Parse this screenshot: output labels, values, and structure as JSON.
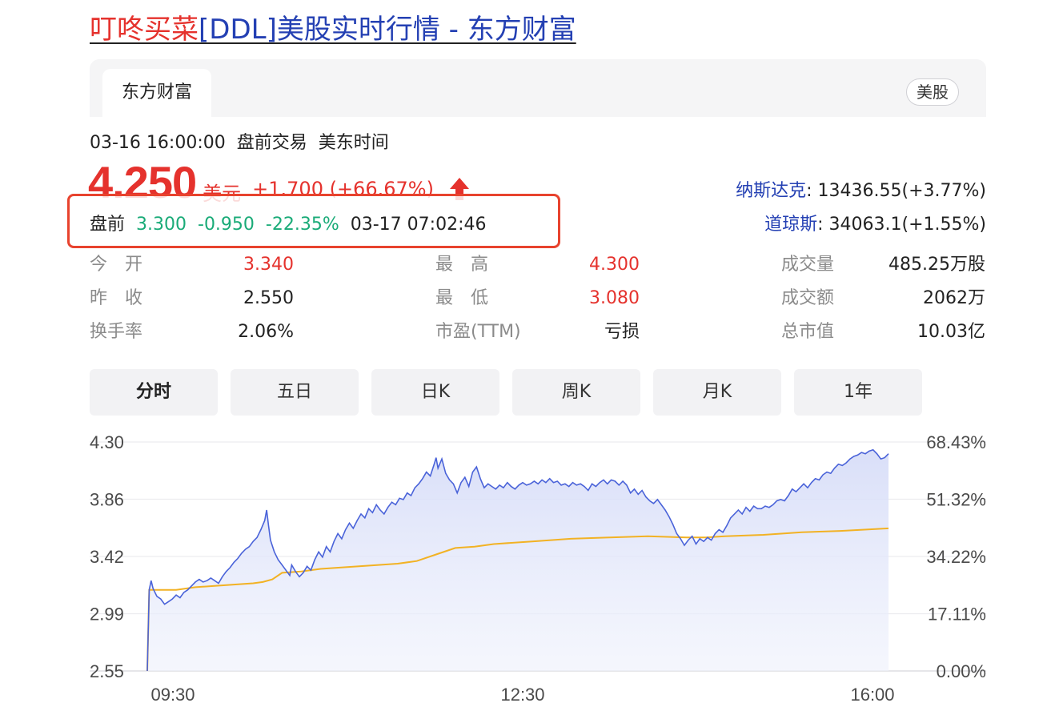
{
  "header": {
    "title_part1": "叮咚买菜",
    "title_part2": "[DDL]美股实时行情 - 东方财富"
  },
  "source": {
    "tab_label": "东方财富",
    "market_badge": "美股"
  },
  "quote": {
    "datetime": "03-16 16:00:00",
    "session": "盘前交易",
    "timezone": "美东时间",
    "price": "4.250",
    "unit": "美元",
    "change": "+1.700 (+66.67%)",
    "up_color": "#e5322d",
    "down_color": "#1aab78"
  },
  "premarket": {
    "label": "盘前",
    "price": "3.300",
    "change": "-0.950",
    "change_pct": "-22.35%",
    "time": "03-17 07:02:46"
  },
  "indices": [
    {
      "name": "纳斯达克",
      "value": ": 13436.55(+3.77%)"
    },
    {
      "name": "道琼斯",
      "value": ": 34063.1(+1.55%)"
    }
  ],
  "stats": {
    "open_label": "今　开",
    "open": "3.340",
    "high_label": "最　高",
    "high": "4.300",
    "volume_label": "成交量",
    "volume": "485.25万股",
    "prev_close_label": "昨　收",
    "prev_close": "2.550",
    "low_label": "最　低",
    "low": "3.080",
    "turnover_label": "成交额",
    "turnover": "2062万",
    "turnover_rate_label": "换手率",
    "turnover_rate": "2.06%",
    "pe_label": "市盈(TTM)",
    "pe": "亏损",
    "market_cap_label": "总市值",
    "market_cap": "10.03亿"
  },
  "range_tabs": [
    "分时",
    "五日",
    "日K",
    "周K",
    "月K",
    "1年"
  ],
  "active_range_tab": 0,
  "chart_data": {
    "type": "line",
    "x_tick_labels": [
      "09:30",
      "12:30",
      "16:00"
    ],
    "y_left_ticks": [
      "4.30",
      "3.86",
      "3.42",
      "2.99",
      "2.55"
    ],
    "y_right_ticks": [
      "68.43%",
      "51.32%",
      "34.22%",
      "17.11%",
      "0.00%"
    ],
    "ylim": [
      2.55,
      4.3
    ],
    "x_range_minutes": [
      0,
      390
    ],
    "grid": true,
    "series": [
      {
        "color": "#4a63d9",
        "fill": "#dfe5fb",
        "points": [
          [
            0,
            2.55
          ],
          [
            1,
            3.17
          ],
          [
            2,
            3.24
          ],
          [
            3,
            3.18
          ],
          [
            5,
            3.12
          ],
          [
            7,
            3.1
          ],
          [
            9,
            3.06
          ],
          [
            11,
            3.08
          ],
          [
            13,
            3.1
          ],
          [
            15,
            3.13
          ],
          [
            17,
            3.11
          ],
          [
            19,
            3.15
          ],
          [
            21,
            3.17
          ],
          [
            23,
            3.2
          ],
          [
            25,
            3.23
          ],
          [
            27,
            3.25
          ],
          [
            29,
            3.23
          ],
          [
            31,
            3.24
          ],
          [
            33,
            3.26
          ],
          [
            35,
            3.24
          ],
          [
            37,
            3.22
          ],
          [
            39,
            3.27
          ],
          [
            41,
            3.31
          ],
          [
            43,
            3.34
          ],
          [
            45,
            3.38
          ],
          [
            47,
            3.41
          ],
          [
            49,
            3.45
          ],
          [
            51,
            3.48
          ],
          [
            53,
            3.5
          ],
          [
            55,
            3.54
          ],
          [
            57,
            3.57
          ],
          [
            59,
            3.63
          ],
          [
            61,
            3.7
          ],
          [
            62,
            3.78
          ],
          [
            63,
            3.66
          ],
          [
            64,
            3.55
          ],
          [
            66,
            3.46
          ],
          [
            68,
            3.4
          ],
          [
            70,
            3.36
          ],
          [
            72,
            3.32
          ],
          [
            74,
            3.28
          ],
          [
            75,
            3.36
          ],
          [
            77,
            3.31
          ],
          [
            79,
            3.27
          ],
          [
            81,
            3.3
          ],
          [
            83,
            3.35
          ],
          [
            85,
            3.32
          ],
          [
            87,
            3.4
          ],
          [
            89,
            3.46
          ],
          [
            91,
            3.42
          ],
          [
            93,
            3.5
          ],
          [
            95,
            3.46
          ],
          [
            97,
            3.54
          ],
          [
            99,
            3.6
          ],
          [
            101,
            3.56
          ],
          [
            103,
            3.63
          ],
          [
            105,
            3.68
          ],
          [
            107,
            3.64
          ],
          [
            109,
            3.7
          ],
          [
            111,
            3.75
          ],
          [
            113,
            3.72
          ],
          [
            115,
            3.79
          ],
          [
            117,
            3.76
          ],
          [
            119,
            3.82
          ],
          [
            121,
            3.78
          ],
          [
            123,
            3.75
          ],
          [
            125,
            3.8
          ],
          [
            127,
            3.84
          ],
          [
            129,
            3.82
          ],
          [
            131,
            3.87
          ],
          [
            133,
            3.86
          ],
          [
            135,
            3.91
          ],
          [
            137,
            3.89
          ],
          [
            139,
            3.95
          ],
          [
            141,
            3.98
          ],
          [
            143,
            4.02
          ],
          [
            145,
            4.07
          ],
          [
            147,
            4.04
          ],
          [
            149,
            4.13
          ],
          [
            150,
            4.18
          ],
          [
            151,
            4.1
          ],
          [
            153,
            4.17
          ],
          [
            155,
            4.06
          ],
          [
            157,
            4.01
          ],
          [
            159,
            3.98
          ],
          [
            161,
            3.91
          ],
          [
            163,
            3.99
          ],
          [
            165,
            4.03
          ],
          [
            167,
            3.96
          ],
          [
            169,
            4.07
          ],
          [
            171,
            4.11
          ],
          [
            173,
            4.02
          ],
          [
            175,
            3.95
          ],
          [
            177,
            3.98
          ],
          [
            179,
            3.96
          ],
          [
            181,
            3.94
          ],
          [
            183,
            3.97
          ],
          [
            185,
            3.95
          ],
          [
            187,
            3.99
          ],
          [
            189,
            3.96
          ],
          [
            191,
            3.94
          ],
          [
            193,
            3.97
          ],
          [
            195,
            3.99
          ],
          [
            197,
            3.97
          ],
          [
            199,
            3.98
          ],
          [
            201,
            4.0
          ],
          [
            203,
            3.98
          ],
          [
            205,
            4.01
          ],
          [
            207,
            3.99
          ],
          [
            209,
            4.02
          ],
          [
            211,
            3.99
          ],
          [
            213,
            4.0
          ],
          [
            215,
            3.97
          ],
          [
            217,
            3.98
          ],
          [
            219,
            3.96
          ],
          [
            221,
            3.99
          ],
          [
            223,
            3.97
          ],
          [
            225,
            3.98
          ],
          [
            227,
            3.96
          ],
          [
            229,
            3.93
          ],
          [
            231,
            3.98
          ],
          [
            233,
            3.96
          ],
          [
            235,
            3.99
          ],
          [
            237,
            4.01
          ],
          [
            239,
            3.98
          ],
          [
            241,
            4.01
          ],
          [
            243,
            4.0
          ],
          [
            245,
            3.97
          ],
          [
            247,
            4.0
          ],
          [
            249,
            3.97
          ],
          [
            251,
            3.91
          ],
          [
            253,
            3.94
          ],
          [
            255,
            3.9
          ],
          [
            257,
            3.93
          ],
          [
            259,
            3.88
          ],
          [
            261,
            3.85
          ],
          [
            263,
            3.83
          ],
          [
            265,
            3.86
          ],
          [
            267,
            3.82
          ],
          [
            269,
            3.78
          ],
          [
            271,
            3.73
          ],
          [
            273,
            3.67
          ],
          [
            275,
            3.6
          ],
          [
            277,
            3.56
          ],
          [
            279,
            3.51
          ],
          [
            281,
            3.55
          ],
          [
            283,
            3.58
          ],
          [
            285,
            3.52
          ],
          [
            287,
            3.56
          ],
          [
            289,
            3.54
          ],
          [
            291,
            3.57
          ],
          [
            293,
            3.55
          ],
          [
            295,
            3.6
          ],
          [
            297,
            3.63
          ],
          [
            299,
            3.61
          ],
          [
            301,
            3.66
          ],
          [
            303,
            3.72
          ],
          [
            305,
            3.75
          ],
          [
            307,
            3.78
          ],
          [
            309,
            3.75
          ],
          [
            311,
            3.8
          ],
          [
            313,
            3.77
          ],
          [
            315,
            3.81
          ],
          [
            317,
            3.79
          ],
          [
            319,
            3.79
          ],
          [
            321,
            3.81
          ],
          [
            323,
            3.8
          ],
          [
            325,
            3.82
          ],
          [
            327,
            3.85
          ],
          [
            329,
            3.86
          ],
          [
            331,
            3.85
          ],
          [
            333,
            3.89
          ],
          [
            335,
            3.94
          ],
          [
            337,
            3.92
          ],
          [
            339,
            3.95
          ],
          [
            341,
            3.98
          ],
          [
            343,
            3.95
          ],
          [
            345,
            3.99
          ],
          [
            347,
            4.02
          ],
          [
            349,
            4.01
          ],
          [
            351,
            4.05
          ],
          [
            353,
            4.07
          ],
          [
            355,
            4.06
          ],
          [
            357,
            4.1
          ],
          [
            359,
            4.13
          ],
          [
            361,
            4.12
          ],
          [
            363,
            4.14
          ],
          [
            365,
            4.17
          ],
          [
            367,
            4.19
          ],
          [
            369,
            4.2
          ],
          [
            371,
            4.22
          ],
          [
            373,
            4.21
          ],
          [
            375,
            4.23
          ],
          [
            377,
            4.24
          ],
          [
            379,
            4.21
          ],
          [
            381,
            4.17
          ],
          [
            383,
            4.18
          ],
          [
            385,
            4.21
          ]
        ]
      },
      {
        "color": "#f2b224",
        "points": [
          [
            0,
            2.55
          ],
          [
            1,
            3.17
          ],
          [
            5,
            3.17
          ],
          [
            15,
            3.17
          ],
          [
            25,
            3.19
          ],
          [
            35,
            3.2
          ],
          [
            45,
            3.21
          ],
          [
            55,
            3.22
          ],
          [
            60,
            3.23
          ],
          [
            65,
            3.25
          ],
          [
            70,
            3.3
          ],
          [
            80,
            3.31
          ],
          [
            90,
            3.33
          ],
          [
            100,
            3.34
          ],
          [
            110,
            3.35
          ],
          [
            120,
            3.36
          ],
          [
            130,
            3.37
          ],
          [
            140,
            3.39
          ],
          [
            150,
            3.44
          ],
          [
            160,
            3.49
          ],
          [
            170,
            3.5
          ],
          [
            180,
            3.52
          ],
          [
            200,
            3.54
          ],
          [
            220,
            3.56
          ],
          [
            240,
            3.57
          ],
          [
            260,
            3.58
          ],
          [
            280,
            3.57
          ],
          [
            290,
            3.57
          ],
          [
            300,
            3.58
          ],
          [
            320,
            3.59
          ],
          [
            340,
            3.61
          ],
          [
            360,
            3.62
          ],
          [
            385,
            3.64
          ]
        ]
      }
    ]
  }
}
